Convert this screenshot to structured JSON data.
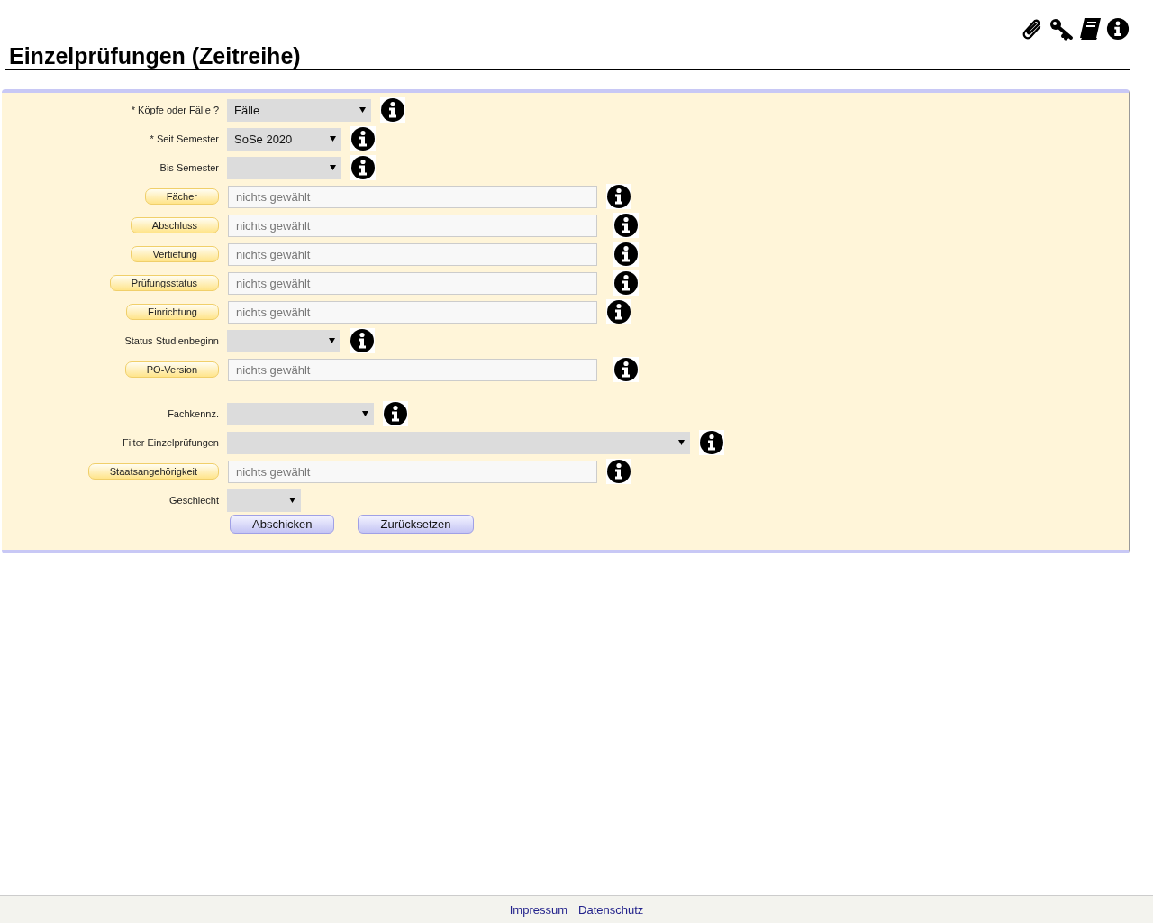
{
  "title": "Einzelprüfungen (Zeitreihe)",
  "fields": [
    {
      "kind": "select",
      "label": "* Köpfe oder Fälle ?",
      "value": "Fälle",
      "info": true
    },
    {
      "kind": "select",
      "label": "* Seit Semester",
      "value": "SoSe 2020",
      "info": true
    },
    {
      "kind": "select",
      "label": "Bis Semester",
      "info": true
    },
    {
      "kind": "picker",
      "label": "Fächer",
      "placeholder": "nichts gewählt",
      "info": true
    },
    {
      "kind": "picker",
      "label": "Abschluss",
      "placeholder": "nichts gewählt",
      "info": true
    },
    {
      "kind": "picker",
      "label": "Vertiefung",
      "placeholder": "nichts gewählt",
      "info": true
    },
    {
      "kind": "picker",
      "label": "Prüfungsstatus",
      "placeholder": "nichts gewählt",
      "info": true
    },
    {
      "kind": "picker",
      "label": "Einrichtung",
      "placeholder": "nichts gewählt",
      "info": true
    },
    {
      "kind": "select",
      "label": "Status Studienbeginn",
      "info": true
    },
    {
      "kind": "picker",
      "label": "PO-Version",
      "placeholder": "nichts gewählt",
      "info": true
    },
    {
      "kind": "select",
      "label": "Fachkennz.",
      "info": true,
      "gap_before": true
    },
    {
      "kind": "select",
      "label": "Filter Einzelprüfungen",
      "info": true
    },
    {
      "kind": "picker",
      "label": "Staatsangehörigkeit",
      "placeholder": "nichts gewählt",
      "info": true
    },
    {
      "kind": "select",
      "label": "Geschlecht",
      "info": false
    }
  ],
  "buttons": [
    "Abschicken",
    "Zurücksetzen"
  ],
  "footer_links": [
    "Impressum",
    "Datenschutz"
  ]
}
